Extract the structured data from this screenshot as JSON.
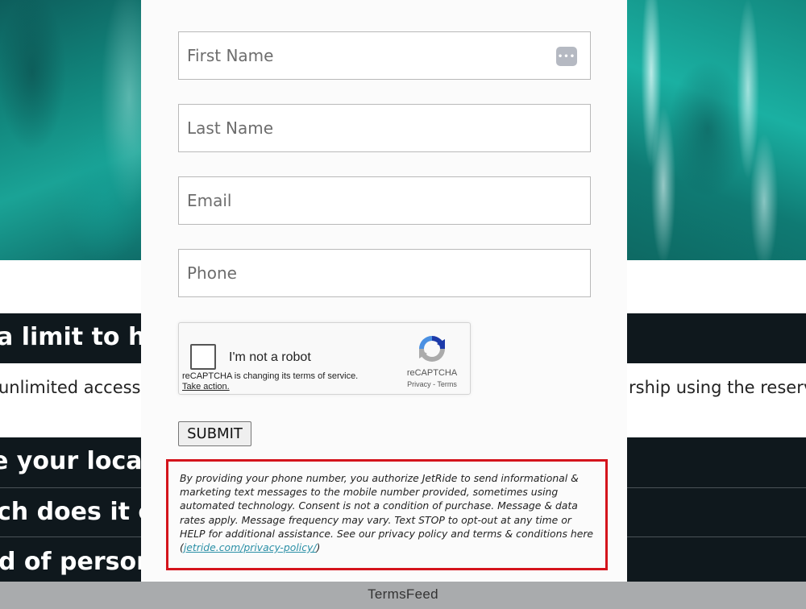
{
  "background": {
    "headings": [
      "a limit to ho",
      "e your locati",
      "ch does it co",
      "d of person"
    ],
    "text_left": "unlimited access to",
    "text_right": "rship using the reserva"
  },
  "form": {
    "first_name_placeholder": "First Name",
    "last_name_placeholder": "Last Name",
    "email_placeholder": "Email",
    "phone_placeholder": "Phone",
    "password_manager_icon": "•••",
    "recaptcha": {
      "label": "I'm not a robot",
      "notice": "reCAPTCHA is changing its terms of service.",
      "action": "Take action.",
      "brand": "reCAPTCHA",
      "links": "Privacy - Terms"
    },
    "submit_label": "SUBMIT"
  },
  "disclaimer": {
    "text": "By providing your phone number, you authorize JetRide to send informational & marketing text messages to the mobile number provided, sometimes using automated technology. Consent is not a condition of purchase. Message & data rates apply. Message frequency may vary. Text STOP to opt-out at any time or HELP for additional assistance. See our privacy policy and terms & conditions here (",
    "link": "jetride.com/privacy-policy/",
    "suffix": ")"
  },
  "footer": {
    "label": "TermsFeed"
  },
  "colors": {
    "highlight_border": "#d4141c",
    "dark_bar": "#0f181d",
    "link": "#2a8fa6",
    "footer_bg": "#a9abad"
  }
}
